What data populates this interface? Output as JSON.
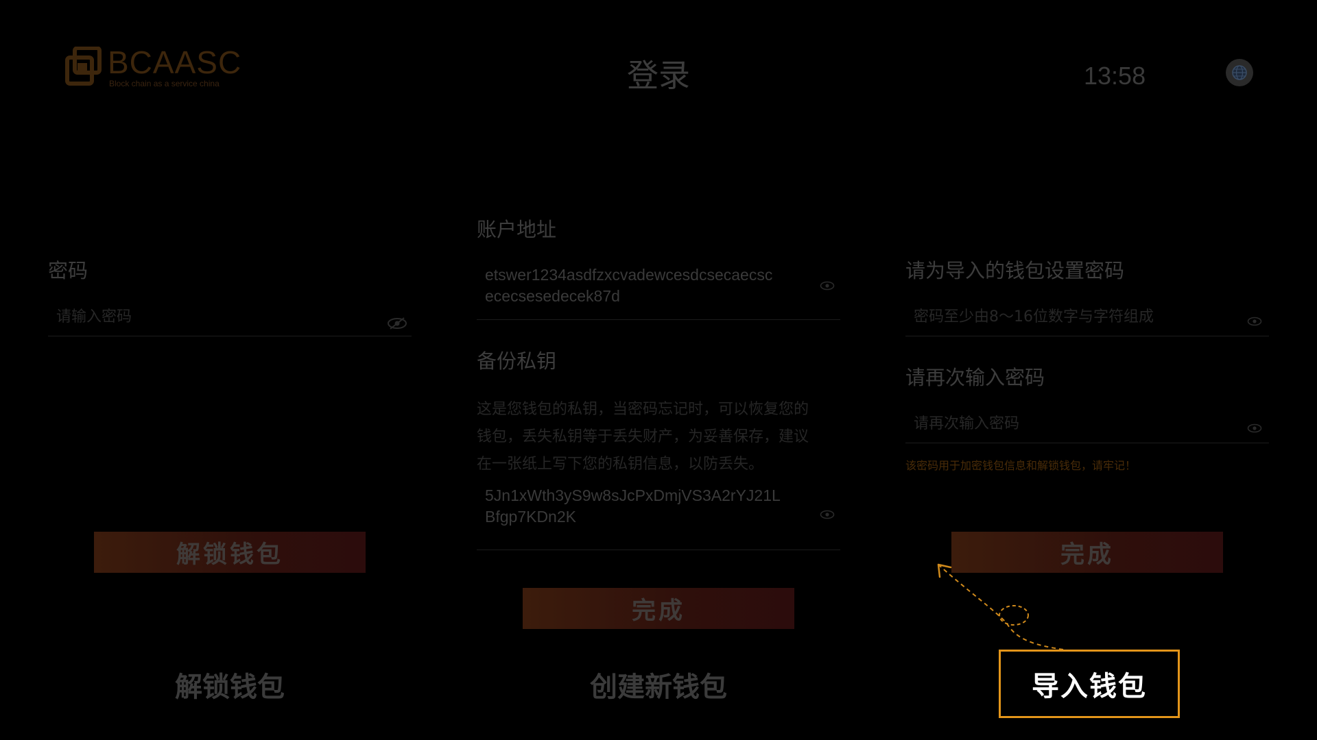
{
  "header": {
    "logo_text": "BCAASC",
    "logo_subtitle": "Block chain as a service china",
    "title": "登录",
    "time": "13:58",
    "language_icon": "globe-icon"
  },
  "unlock_panel": {
    "password_label": "密码",
    "password_placeholder": "请输入密码",
    "unlock_button": "解锁钱包"
  },
  "create_panel": {
    "address_label": "账户地址",
    "address_value_line1": "etswer1234asdfzxcvadewcesdcsecaecsc",
    "address_value_line2": "ececsesedecek87d",
    "private_key_label": "备份私钥",
    "private_key_desc_line1": "这是您钱包的私钥，当密码忘记时，可以恢复您的",
    "private_key_desc_line2": "钱包，丢失私钥等于丢失财产，为妥善保存，建议",
    "private_key_desc_line3": "在一张纸上写下您的私钥信息，以防丢失。",
    "private_key_value_line1": "5Jn1xWth3yS9w8sJcPxDmjVS3A2rYJ21L",
    "private_key_value_line2": "Bfgp7KDn2K",
    "done_button": "完成"
  },
  "import_panel": {
    "set_password_label": "请为导入的钱包设置密码",
    "set_password_placeholder": "密码至少由8～16位数字与字符组成",
    "confirm_password_label": "请再次输入密码",
    "confirm_password_placeholder": "请再次输入密码",
    "hint": "该密码用于加密钱包信息和解锁钱包，请牢记！",
    "done_button": "完成"
  },
  "tabs": {
    "unlock": "解锁钱包",
    "create": "创建新钱包",
    "import": "导入钱包"
  },
  "colors": {
    "background": "#000000",
    "accent_border": "#e3951a",
    "hint_text": "#4a2c08",
    "button_dimmed": "#3c1c0c"
  }
}
